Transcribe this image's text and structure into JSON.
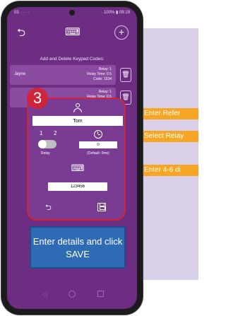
{
  "status_bar": {
    "left": "03 · · · ·",
    "right": "· 100% ▮ 09:19"
  },
  "header": {
    "back_icon": "back-arrow-icon",
    "center_icon": "keypad-icon",
    "add_icon": "plus-circle-icon"
  },
  "section": {
    "title": "Add and Delete Keypad Codes:"
  },
  "codes": [
    {
      "name": "Jayne",
      "relay": "Relay: 1",
      "time": "Relay Time: 0.5",
      "code": "Code: 1234"
    },
    {
      "name": "",
      "relay": "Relay: 1",
      "time": "Relay Time: 0.5",
      "code": ""
    }
  ],
  "form": {
    "step": "3",
    "name_value": "Tom",
    "relay_options": [
      "1",
      "2"
    ],
    "relay_label": "Relay",
    "relay_selected": "1",
    "time_value": "0",
    "time_label": "(Default: 0ms)",
    "code_value": "123456"
  },
  "callout": {
    "text": "Enter details and click SAVE"
  },
  "side_hints": [
    "Enter Refer",
    "Select Relay",
    "Enter 4-6 di"
  ],
  "colors": {
    "screen_bg": "#6c2d83",
    "highlight": "#d0243a",
    "callout": "#2f6bb5",
    "hint": "#f6a623"
  }
}
